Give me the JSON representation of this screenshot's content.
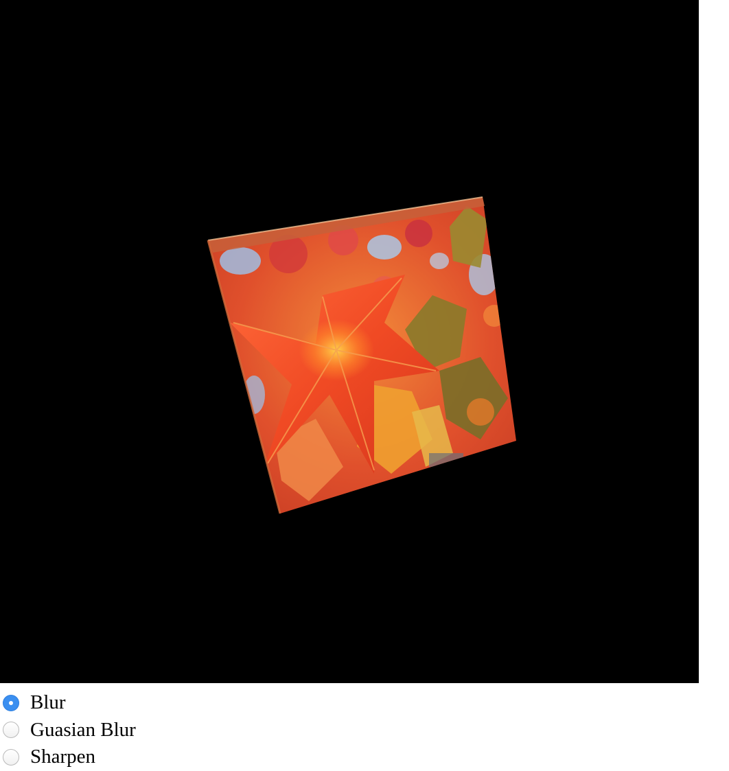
{
  "canvas": {
    "background": "#000000",
    "scene": "textured-cube-autumn-leaves"
  },
  "filters": {
    "selected": "blur",
    "options": [
      {
        "id": "blur",
        "label": "Blur",
        "checked": true
      },
      {
        "id": "gaussian-blur",
        "label": "Guasian Blur",
        "checked": false
      },
      {
        "id": "sharpen",
        "label": "Sharpen",
        "checked": false
      }
    ]
  },
  "colors": {
    "radio_checked": "#3b8ff0",
    "leaf_red": "#e8412a",
    "leaf_orange": "#f07a2a",
    "leaf_olive": "#8a7a2a",
    "sky_blue": "#9cc4ee"
  }
}
